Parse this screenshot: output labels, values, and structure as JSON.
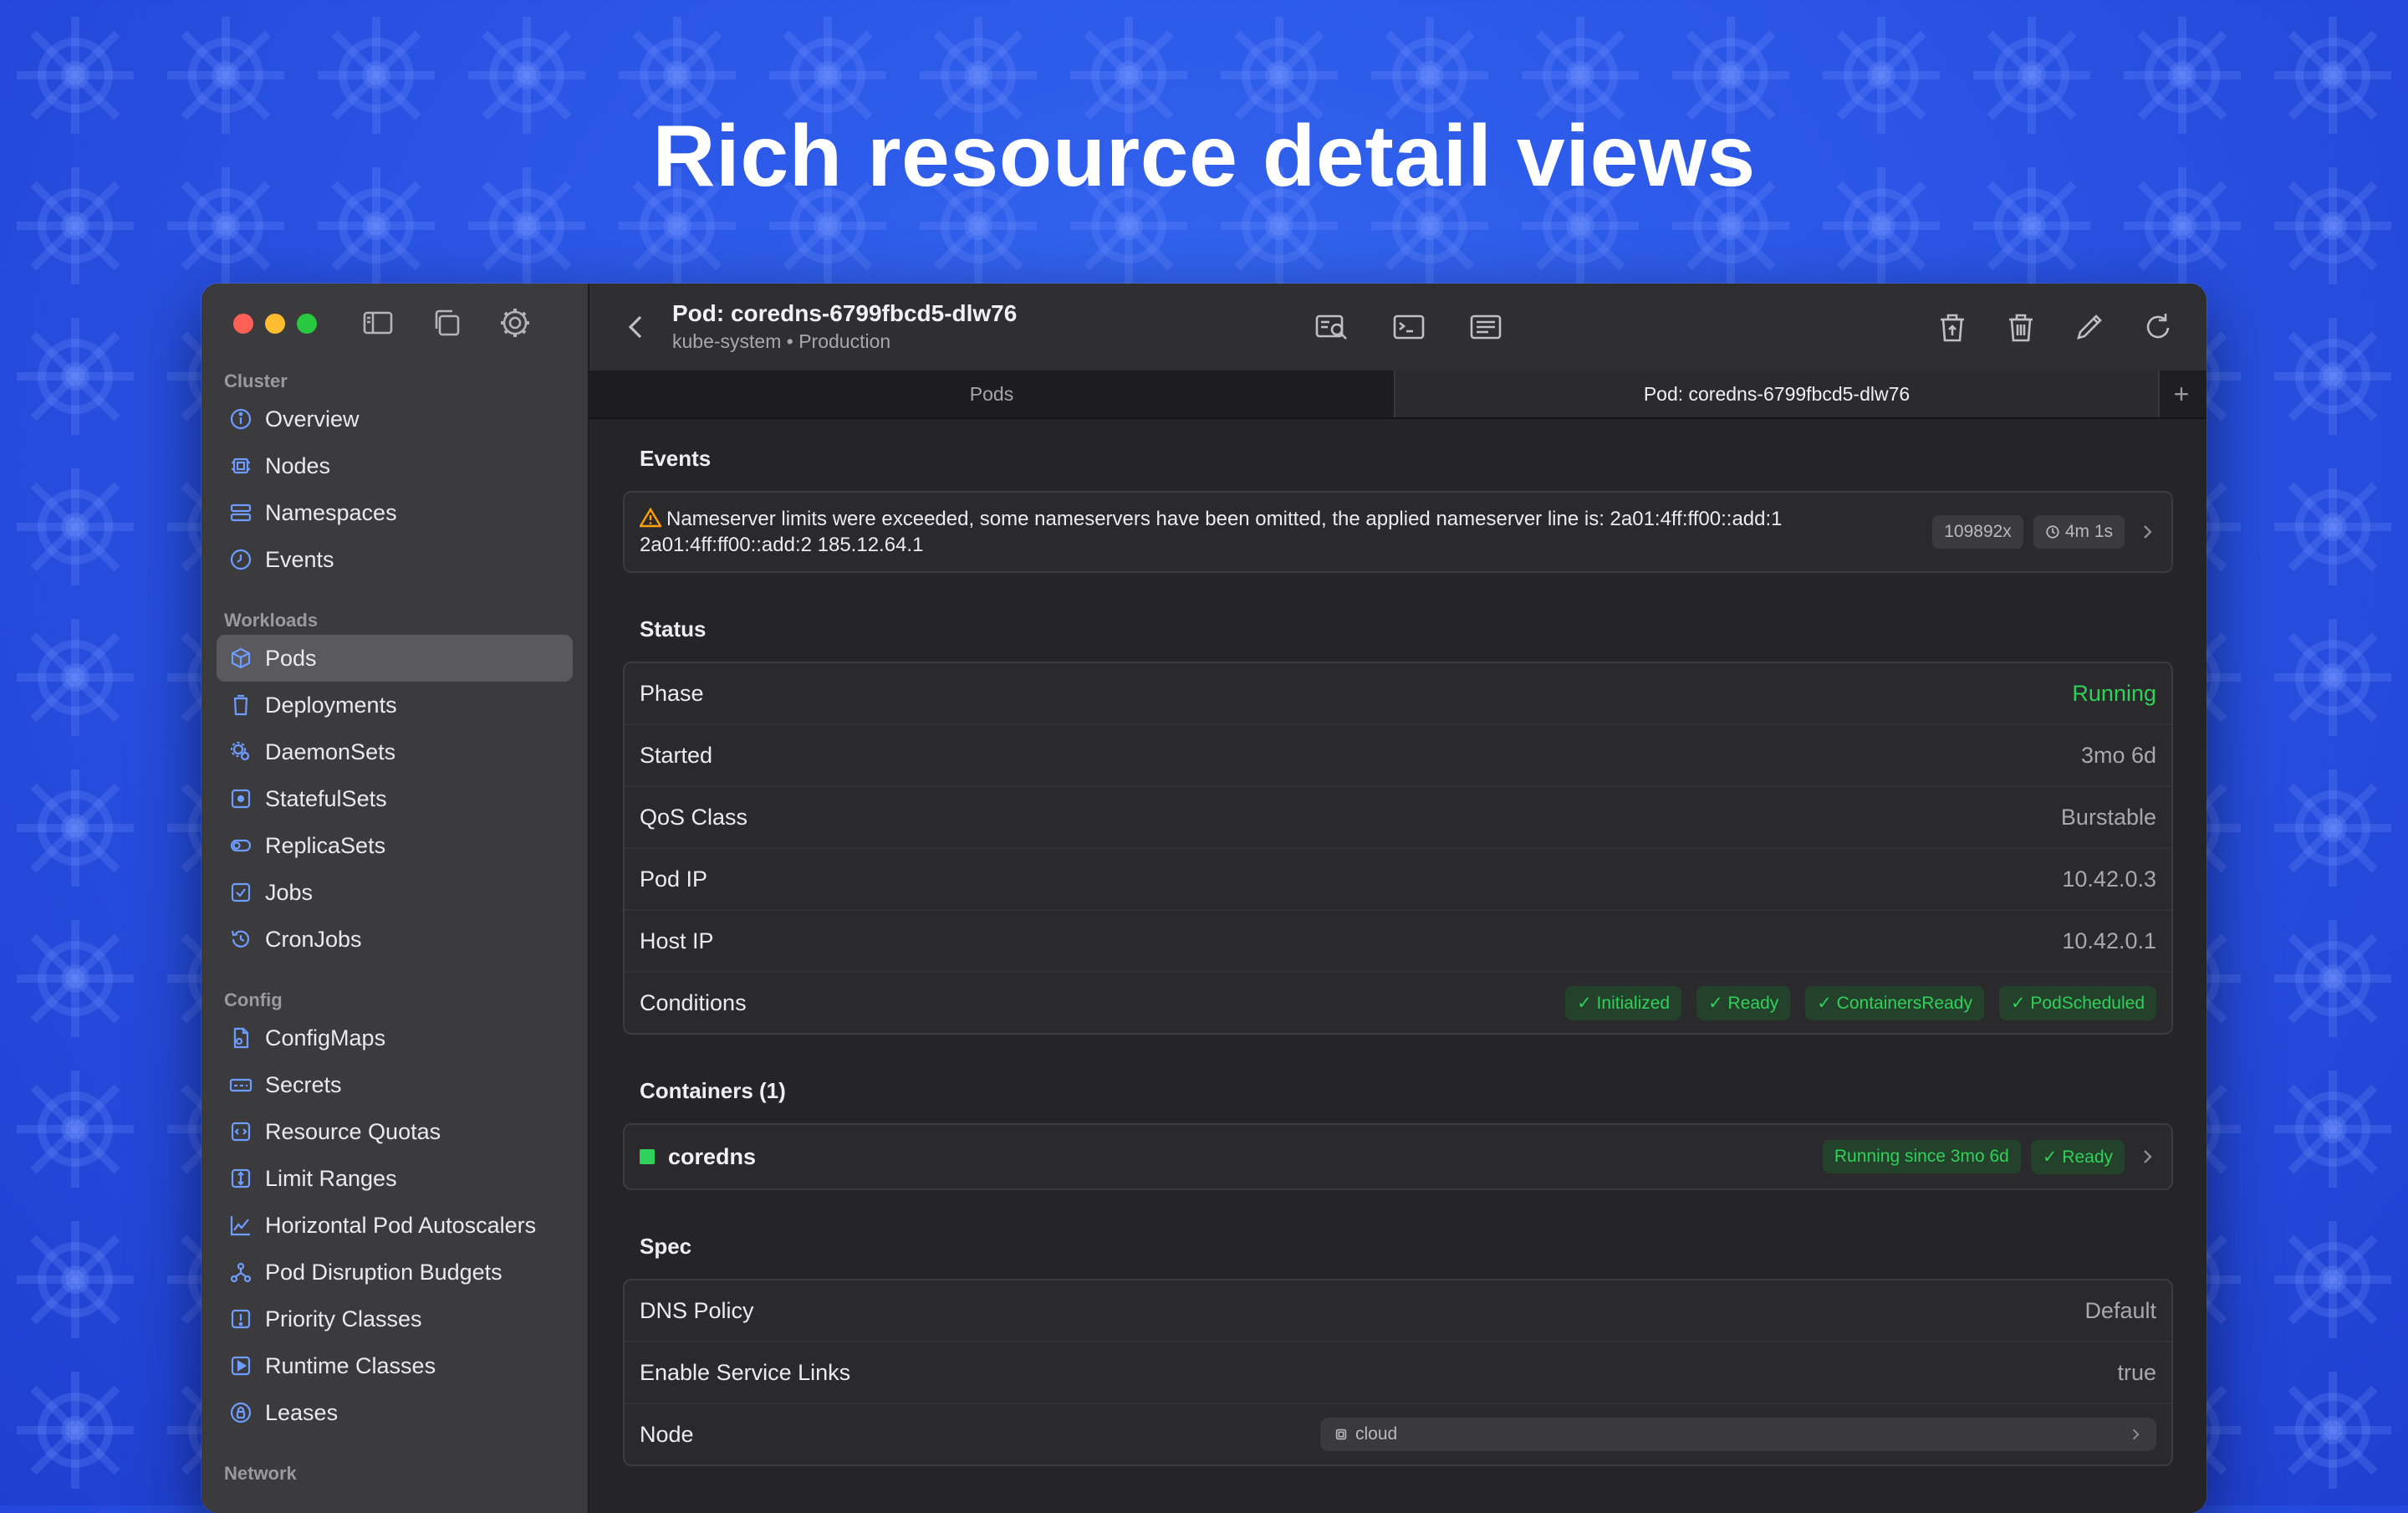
{
  "headline": "Rich resource detail views",
  "sidebar": {
    "sections": [
      {
        "label": "Cluster",
        "items": [
          {
            "label": "Overview",
            "icon": "info-icon"
          },
          {
            "label": "Nodes",
            "icon": "chip-icon"
          },
          {
            "label": "Namespaces",
            "icon": "stack-icon"
          },
          {
            "label": "Events",
            "icon": "clock-icon"
          }
        ]
      },
      {
        "label": "Workloads",
        "items": [
          {
            "label": "Pods",
            "icon": "cube-icon",
            "active": true
          },
          {
            "label": "Deployments",
            "icon": "bucket-icon"
          },
          {
            "label": "DaemonSets",
            "icon": "gears-icon"
          },
          {
            "label": "StatefulSets",
            "icon": "square-dot-icon"
          },
          {
            "label": "ReplicaSets",
            "icon": "toggle-icon"
          },
          {
            "label": "Jobs",
            "icon": "checkbox-icon"
          },
          {
            "label": "CronJobs",
            "icon": "history-icon"
          }
        ]
      },
      {
        "label": "Config",
        "items": [
          {
            "label": "ConfigMaps",
            "icon": "doc-icon"
          },
          {
            "label": "Secrets",
            "icon": "key-icon"
          },
          {
            "label": "Resource Quotas",
            "icon": "gauge-icon"
          },
          {
            "label": "Limit Ranges",
            "icon": "range-icon"
          },
          {
            "label": "Horizontal Pod Autoscalers",
            "icon": "chart-icon"
          },
          {
            "label": "Pod Disruption Budgets",
            "icon": "network-icon"
          },
          {
            "label": "Priority Classes",
            "icon": "exclaim-icon"
          },
          {
            "label": "Runtime Classes",
            "icon": "play-icon"
          },
          {
            "label": "Leases",
            "icon": "lock-circle-icon"
          }
        ]
      },
      {
        "label": "Network",
        "items": []
      }
    ]
  },
  "toolbar": {
    "title": "Pod: coredns-6799fbcd5-dlw76",
    "subtitle": "kube-system • Production"
  },
  "tabs": [
    "Pods",
    "Pod: coredns-6799fbcd5-dlw76",
    "+"
  ],
  "events": {
    "title": "Events",
    "message": "Nameserver limits were exceeded, some nameservers have been omitted, the applied nameserver line is: 2a01:4ff:ff00::add:1 2a01:4ff:ff00::add:2 185.12.64.1",
    "count": "109892x",
    "age": "4m 1s"
  },
  "status": {
    "title": "Status",
    "rows": [
      {
        "key": "Phase",
        "value": "Running"
      },
      {
        "key": "Started",
        "value": "3mo 6d"
      },
      {
        "key": "QoS Class",
        "value": "Burstable"
      },
      {
        "key": "Pod IP",
        "value": "10.42.0.3"
      },
      {
        "key": "Host IP",
        "value": "10.42.0.1"
      }
    ],
    "conditions_label": "Conditions",
    "conditions": [
      "✓ Initialized",
      "✓ Ready",
      "✓ ContainersReady",
      "✓ PodScheduled"
    ]
  },
  "containers": {
    "title": "Containers (1)",
    "name": "coredns",
    "running": "Running since 3mo 6d",
    "ready": "✓ Ready"
  },
  "spec": {
    "title": "Spec",
    "rows": [
      {
        "key": "DNS Policy",
        "value": "Default"
      },
      {
        "key": "Enable Service Links",
        "value": "true"
      }
    ],
    "node_label": "Node",
    "node_value": "cloud"
  },
  "colors": {
    "accent_green": "#30d158",
    "background_blue": "#2a55e6",
    "icon_blue": "#6f9cff"
  }
}
